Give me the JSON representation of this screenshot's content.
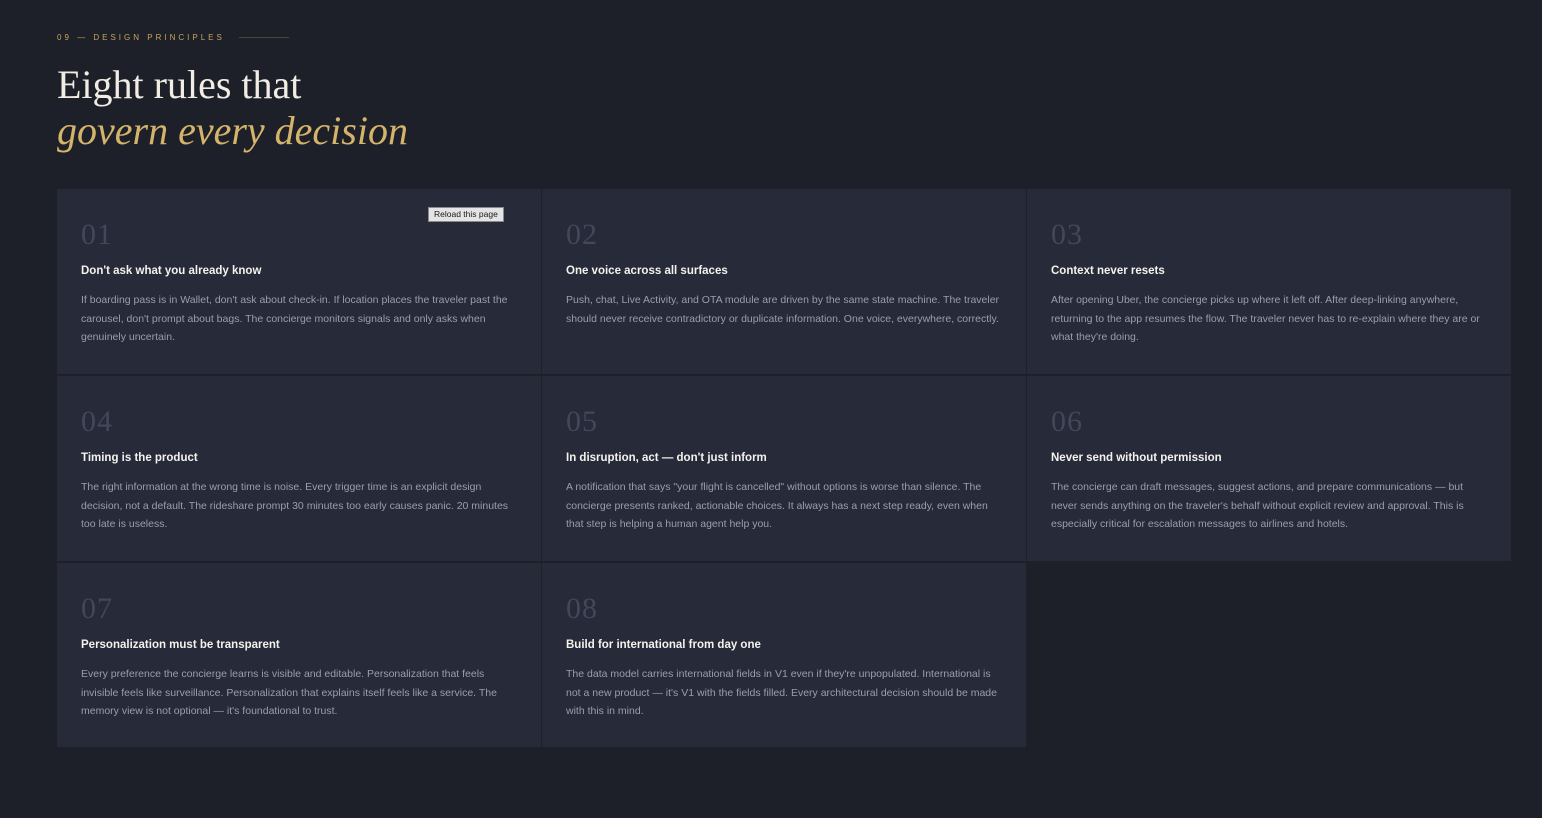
{
  "section": {
    "eyebrow": "09 — Design Principles",
    "title_line1": "Eight rules that",
    "title_line2": "govern every decision"
  },
  "reload_button": {
    "label": "Reload this page"
  },
  "principles": [
    {
      "number": "01",
      "heading": "Don't ask what you already know",
      "body": "If boarding pass is in Wallet, don't ask about check-in. If location places the traveler past the carousel, don't prompt about bags. The concierge monitors signals and only asks when genuinely uncertain."
    },
    {
      "number": "02",
      "heading": "One voice across all surfaces",
      "body": "Push, chat, Live Activity, and OTA module are driven by the same state machine. The traveler should never receive contradictory or duplicate information. One voice, everywhere, correctly."
    },
    {
      "number": "03",
      "heading": "Context never resets",
      "body": "After opening Uber, the concierge picks up where it left off. After deep-linking anywhere, returning to the app resumes the flow. The traveler never has to re-explain where they are or what they're doing."
    },
    {
      "number": "04",
      "heading": "Timing is the product",
      "body": "The right information at the wrong time is noise. Every trigger time is an explicit design decision, not a default. The rideshare prompt 30 minutes too early causes panic. 20 minutes too late is useless."
    },
    {
      "number": "05",
      "heading": "In disruption, act — don't just inform",
      "body": "A notification that says \"your flight is cancelled\" without options is worse than silence. The concierge presents ranked, actionable choices. It always has a next step ready, even when that step is helping a human agent help you."
    },
    {
      "number": "06",
      "heading": "Never send without permission",
      "body": "The concierge can draft messages, suggest actions, and prepare communications — but never sends anything on the traveler's behalf without explicit review and approval. This is especially critical for escalation messages to airlines and hotels."
    },
    {
      "number": "07",
      "heading": "Personalization must be transparent",
      "body": "Every preference the concierge learns is visible and editable. Personalization that feels invisible feels like surveillance. Personalization that explains itself feels like a service. The memory view is not optional — it's foundational to trust."
    },
    {
      "number": "08",
      "heading": "Build for international from day one",
      "body": "The data model carries international fields in V1 even if they're unpopulated. International is not a new product — it's V1 with the fields filled. Every architectural decision should be made with this in mind."
    }
  ],
  "colors": {
    "background": "#1e2029",
    "card": "#262a39",
    "accent_gold": "#d4b46a",
    "title": "#f1ede4",
    "body_text": "#9b9fac",
    "number_muted": "#44475a"
  }
}
